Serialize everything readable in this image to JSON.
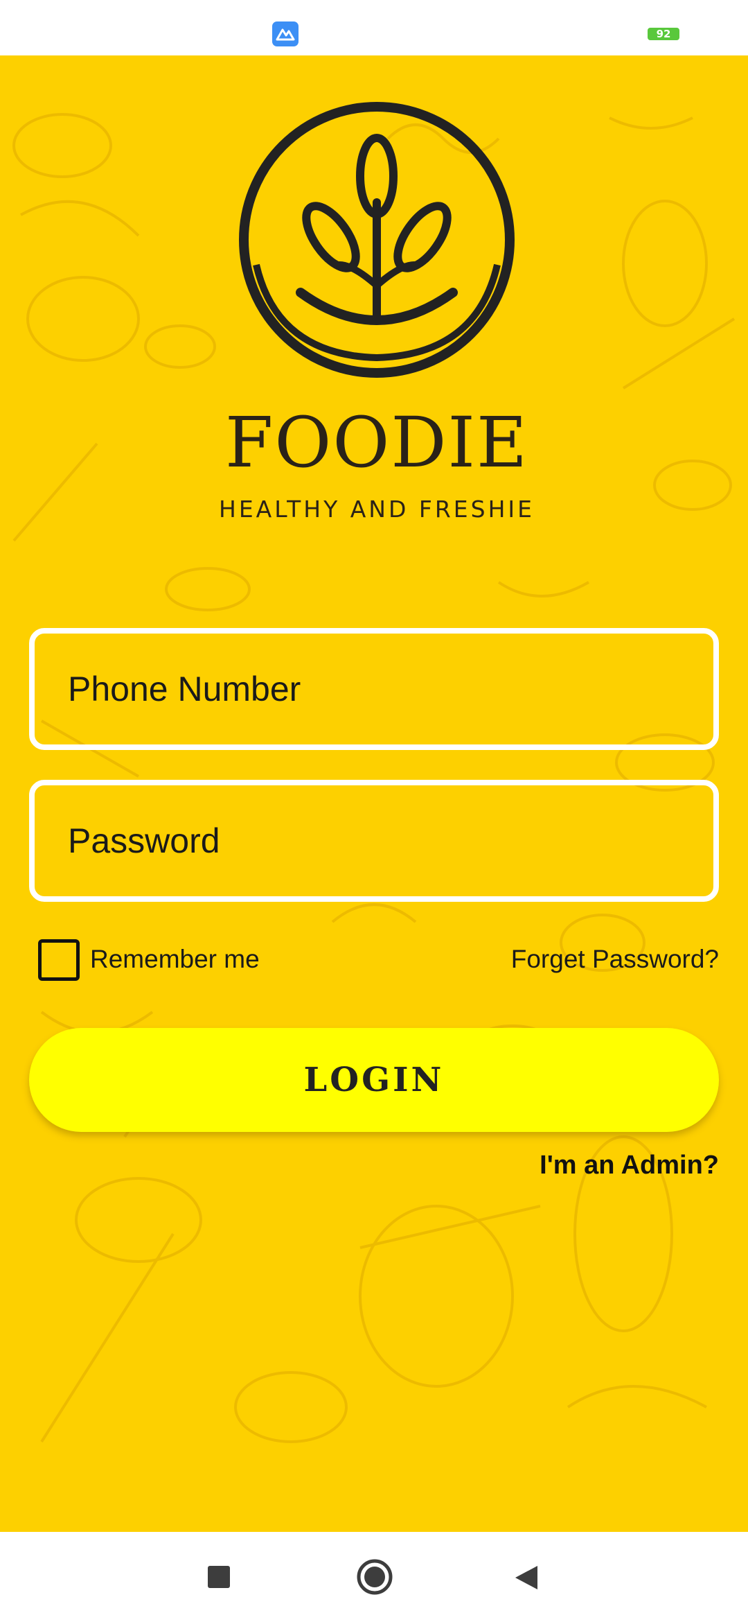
{
  "status_bar": {
    "battery_level": "92",
    "icons": [
      "app-notification-icon",
      "battery-icon"
    ]
  },
  "brand": {
    "title": "FOODIE",
    "tagline": "HEALTHY AND FRESHIE",
    "logo_icon": "sprout-in-circle-logo"
  },
  "form": {
    "phone_placeholder": "Phone Number",
    "password_placeholder": "Password",
    "remember_label": "Remember me",
    "remember_checked": false,
    "forget_password": "Forget Password?",
    "login_label": "LOGIN",
    "admin_link": "I'm an Admin?"
  },
  "nav_bar": {
    "buttons": [
      "recents-icon",
      "home-icon",
      "back-icon"
    ]
  },
  "colors": {
    "background": "#fdd000",
    "button": "#ffff00",
    "field_border": "#ffffff",
    "text": "#1a1a1a"
  }
}
